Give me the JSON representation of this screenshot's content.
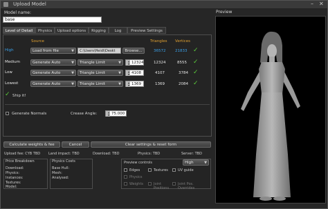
{
  "window": {
    "title": "Upload Model",
    "preview_label": "Preview"
  },
  "model_name": {
    "label": "Model name:",
    "value": "base"
  },
  "tabs": [
    {
      "label": "Level of Detail",
      "active": true
    },
    {
      "label": "Physics",
      "active": false
    },
    {
      "label": "Upload options",
      "active": false
    },
    {
      "label": "Rigging",
      "active": false
    },
    {
      "label": "Log",
      "active": false
    },
    {
      "label": "Preview Settings",
      "active": false
    }
  ],
  "lod": {
    "headers": {
      "source": "Source",
      "triangles": "Triangles",
      "vertices": "Vertices"
    },
    "rows": [
      {
        "label": "High",
        "source": "Load from file",
        "path": "C:\\Users\\Heidi\\Deskt",
        "button": "Browse...",
        "triangles": "36572",
        "vertices": "21833"
      },
      {
        "label": "Medium",
        "source": "Generate Auto",
        "method": "Triangle Limit",
        "limit": "12324",
        "triangles": "12324",
        "vertices": "8555"
      },
      {
        "label": "Low",
        "source": "Generate Auto",
        "method": "Triangle Limit",
        "limit": "4108",
        "triangles": "4107",
        "vertices": "3784"
      },
      {
        "label": "Lowest",
        "source": "Generate Auto",
        "method": "Triangle Limit",
        "limit": "1369",
        "triangles": "1369",
        "vertices": "2084"
      }
    ],
    "ship_it": "Ship it!",
    "generate_normals": "Generate Normals",
    "crease_label": "Crease Angle:",
    "crease_value": "75.000"
  },
  "buttons": {
    "calculate": "Calculate weights & fee",
    "cancel": "Cancel",
    "clear": "Clear settings & reset form"
  },
  "fees": {
    "upload_fee": "Upload fee: CYB TBD",
    "land_impact": "Land impact: TBD",
    "download": "Download: TBD",
    "physics": "Physics: TBD",
    "server": "Server: TBD"
  },
  "price_breakdown": {
    "title": "Price Breakdown",
    "items": [
      "Download:",
      "Physics:",
      "Instances:",
      "Textures:",
      "Model:"
    ]
  },
  "physics_costs": {
    "title": "Physics Costs",
    "items": [
      "Base Hull:",
      "Mesh:",
      "Analysed:"
    ]
  },
  "preview_controls": {
    "title": "Preview controls",
    "quality": "High",
    "checks": [
      "Edges",
      "Textures",
      "UV guide"
    ],
    "disabled": [
      "Physics",
      "Weights",
      "Joint Positions",
      "Joint Pos. Overrides"
    ]
  }
}
